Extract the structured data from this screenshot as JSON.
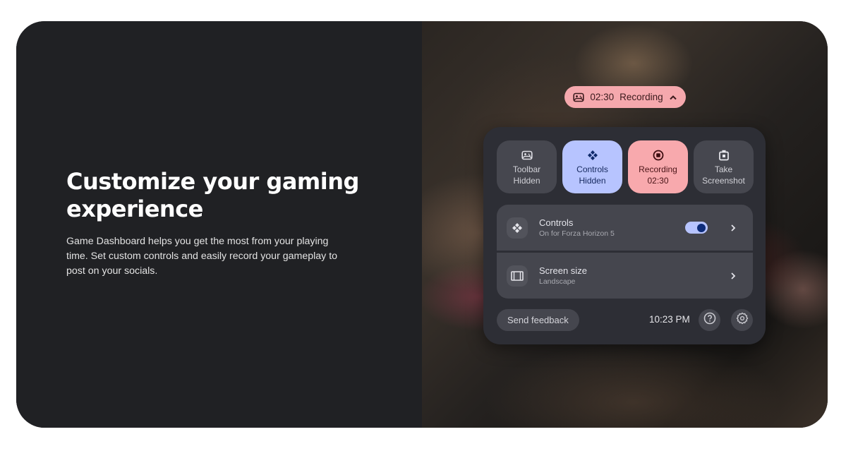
{
  "intro": {
    "headline": "Customize your gaming experience",
    "description": "Game Dashboard helps you get the most from your playing time. Set custom controls and easily record your gameplay to post on your socials."
  },
  "recording_pill": {
    "icon": "gamepad-icon",
    "time": "02:30",
    "label": "Recording",
    "chevron": "chevron-up-icon"
  },
  "tiles": [
    {
      "icon": "gamepad-icon",
      "line1": "Toolbar",
      "line2": "Hidden",
      "state": "default"
    },
    {
      "icon": "dpad-icon",
      "line1": "Controls",
      "line2": "Hidden",
      "state": "active-blue"
    },
    {
      "icon": "record-stop-icon",
      "line1": "Recording",
      "line2": "02:30",
      "state": "active-red"
    },
    {
      "icon": "camera-icon",
      "line1": "Take",
      "line2": "Screenshot",
      "state": "default"
    }
  ],
  "settings_list": [
    {
      "icon": "dpad-icon",
      "title": "Controls",
      "subtitle": "On for Forza Horizon 5",
      "toggle_on": true
    },
    {
      "icon": "screen-size-icon",
      "title": "Screen size",
      "subtitle": "Landscape"
    }
  ],
  "footer": {
    "feedback_label": "Send feedback",
    "time": "10:23 PM",
    "help_icon": "help-icon",
    "settings_icon": "gear-icon"
  },
  "colors": {
    "recording_red": "#f8a9ad",
    "controls_blue": "#b7c4ff",
    "panel": "#2d2e35",
    "left_bg": "#202124"
  }
}
